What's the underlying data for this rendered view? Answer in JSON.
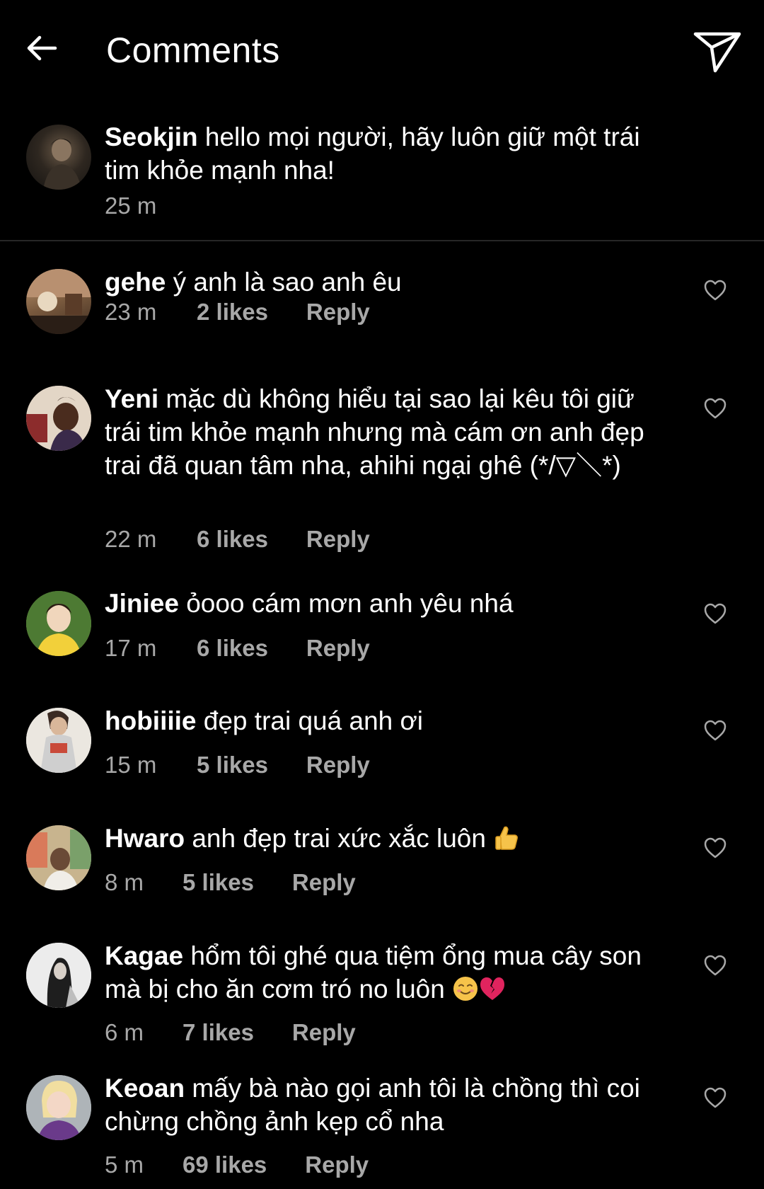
{
  "header": {
    "title": "Comments",
    "back_icon": "arrow-left-icon",
    "share_icon": "paper-plane-icon"
  },
  "caption": {
    "username": "Seokjin",
    "text": "hello mọi người, hãy luôn giữ một trái tim khỏe mạnh nha!",
    "time": "25 m"
  },
  "comments": [
    {
      "username": "gehe",
      "text": "ý anh là sao anh êu",
      "time": "23 m",
      "likes": "2 likes",
      "reply": "Reply"
    },
    {
      "username": "Yeni",
      "text": "mặc dù không hiểu tại sao lại kêu tôi giữ trái tim khỏe mạnh nhưng mà cám ơn anh đẹp trai đã quan tâm nha, ahihi ngại ghê (*/▽＼*)",
      "time": "22 m",
      "likes": "6 likes",
      "reply": "Reply"
    },
    {
      "username": "Jiniee",
      "text": "ỏooo cám mơn anh yêu nhá",
      "time": "17 m",
      "likes": "6 likes",
      "reply": "Reply"
    },
    {
      "username": "hobiiiie",
      "text": "đẹp trai quá anh ơi",
      "time": "15 m",
      "likes": "5 likes",
      "reply": "Reply"
    },
    {
      "username": "Hwaro",
      "text": "anh đẹp trai xức xắc luôn",
      "emoji": "thumbs-up-emoji",
      "time": "8 m",
      "likes": "5 likes",
      "reply": "Reply"
    },
    {
      "username": "Kagae",
      "text": "hổm tôi ghé qua tiệm ổng mua cây son mà bị cho ăn cơm tró no luôn",
      "emoji": "smiling-face-broken-heart-emoji",
      "time": "6 m",
      "likes": "7 likes",
      "reply": "Reply"
    },
    {
      "username": "Keoan",
      "text": "mấy bà nào gọi anh tôi là chồng thì coi chừng chồng ảnh kẹp cổ nha",
      "time": "5 m",
      "likes": "69 likes",
      "reply": "Reply"
    }
  ],
  "colors": {
    "background": "#000000",
    "text": "#ffffff",
    "secondary_text": "#a8a8a8",
    "divider": "#262626"
  }
}
